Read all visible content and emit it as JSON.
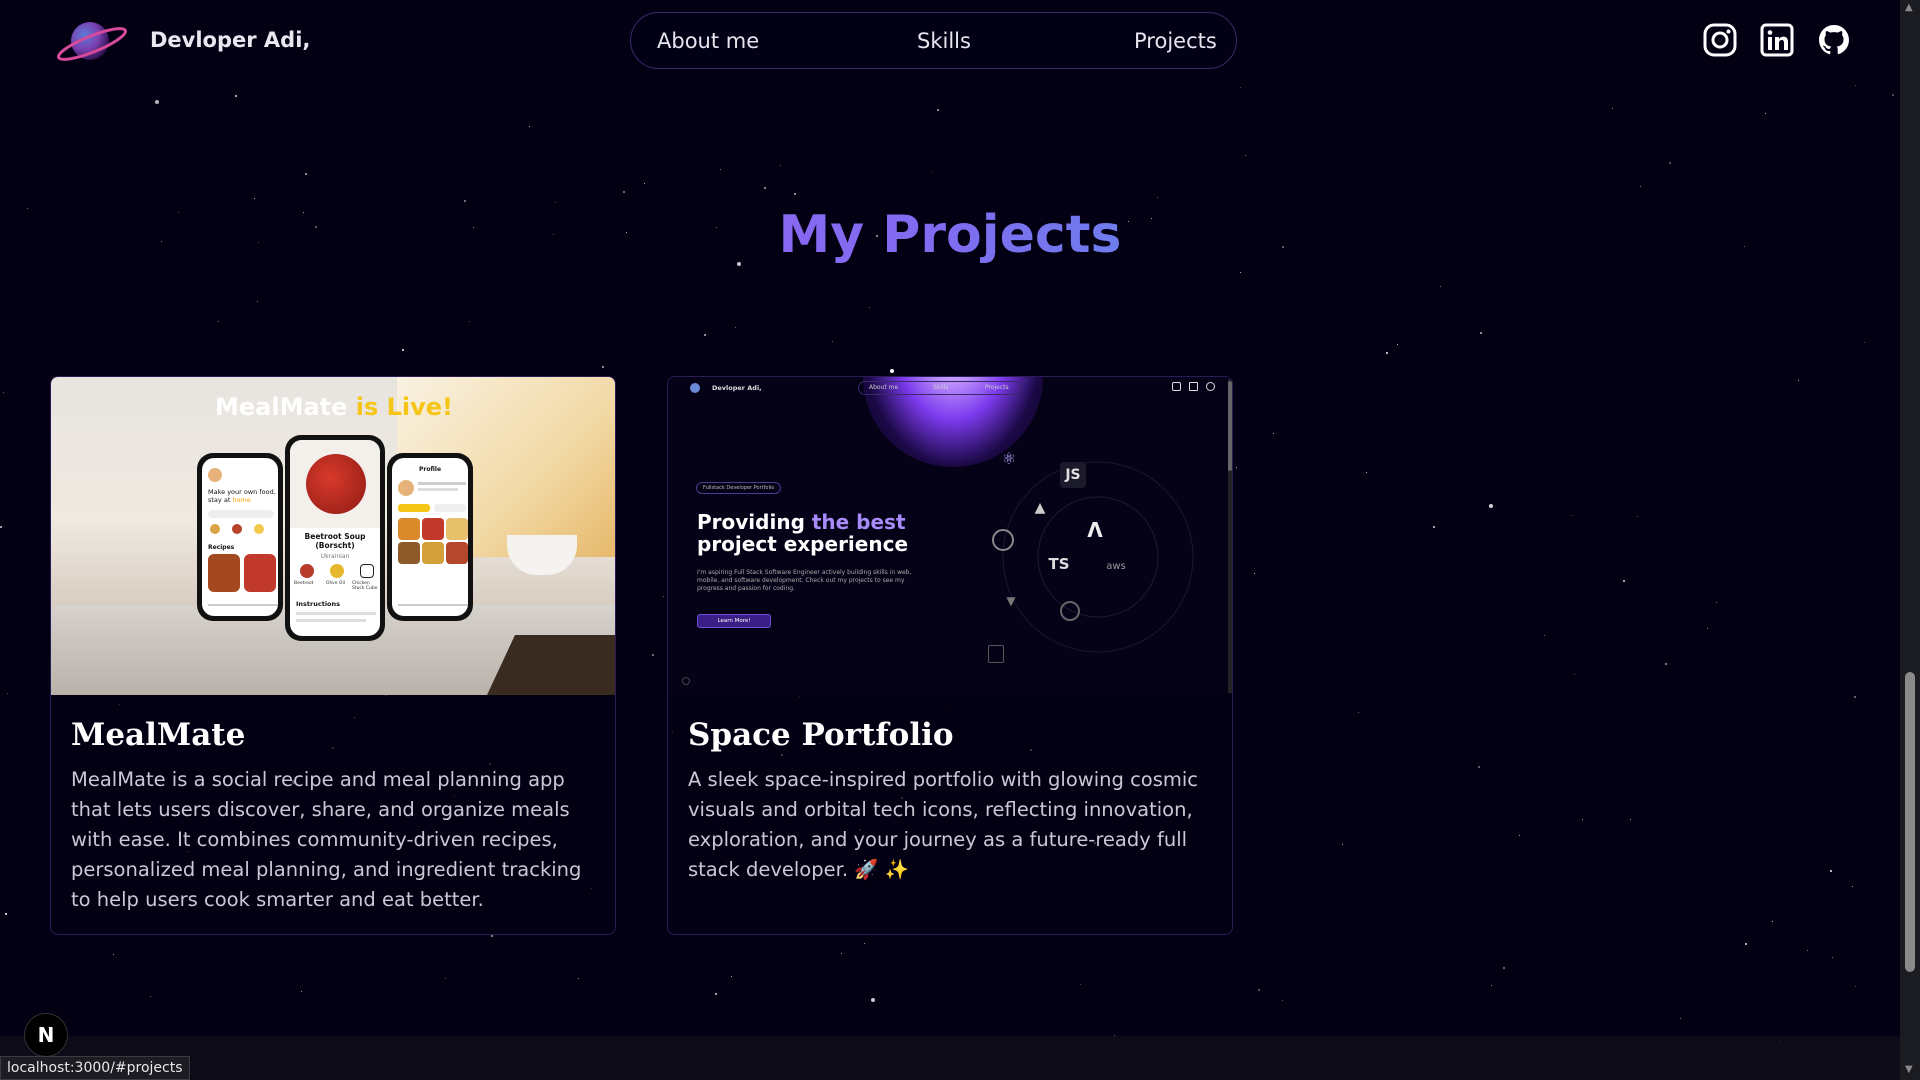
{
  "header": {
    "brand": "Devloper Adi,",
    "nav": [
      {
        "label": "About me"
      },
      {
        "label": "Skills"
      },
      {
        "label": "Projects"
      }
    ],
    "social": [
      "instagram-icon",
      "linkedin-icon",
      "github-icon"
    ]
  },
  "main": {
    "heading": "My Projects",
    "projects": [
      {
        "title": "MealMate",
        "description": "MealMate is a social recipe and meal planning app that lets users discover, share, and organize meals with ease. It combines community-driven recipes, personalized meal planning, and ingredient tracking to help users cook smarter and eat better.",
        "image": {
          "headline_a": "MealMate ",
          "headline_b": "is Live!",
          "phone1_line1": "Make your own food,",
          "phone1_line2": "stay at ",
          "phone1_highlight": "home",
          "phone1_section": "Recipes",
          "phone2_dish": "Beetroot Soup",
          "phone2_dish_sub": "(Borscht)",
          "phone2_cuisine": "Ukrainian",
          "phone2_section": "Instructions",
          "phone2_ingredients": [
            "Beetroot",
            "Olive Oil",
            "Chicken Stock Cube"
          ],
          "phone3_header": "Profile"
        }
      },
      {
        "title": "Space Portfolio",
        "description": "A sleek space-inspired portfolio with glowing cosmic visuals and orbital tech icons, reflecting innovation, exploration, and your journey as a future-ready full stack developer. 🚀 ✨",
        "image": {
          "brand": "Devloper Adi,",
          "nav": [
            "About me",
            "Skills",
            "Projects"
          ],
          "badge": "Fullstack Developer Portfolio",
          "headline_a": "Providing ",
          "headline_highlight": "the best",
          "headline_b": "project experience",
          "body": "I'm aspiring Full Stack Software Engineer actively building skills in web, mobile, and software development. Check out my projects to see my progress and passion for coding.",
          "cta": "Learn More!",
          "tech": [
            "JS",
            "TS",
            "aws"
          ]
        }
      }
    ]
  },
  "footer": {
    "next_badge": "N",
    "status_url": "localhost:3000/#projects"
  },
  "colors": {
    "background": "#030014",
    "heading_gradient_start": "#a855f7",
    "heading_gradient_end": "#22c8e0",
    "highlight_yellow": "#f5c518",
    "highlight_purple": "#a78bfa"
  }
}
